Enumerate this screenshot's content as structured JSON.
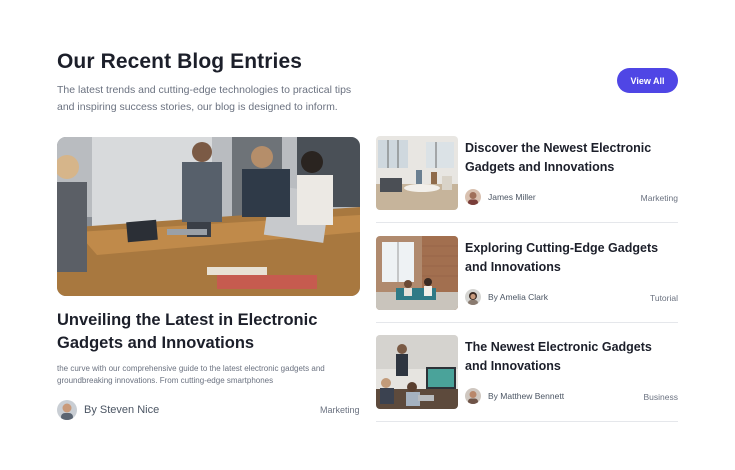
{
  "header": {
    "title": "Our Recent Blog Entries",
    "subtitle": "The latest trends and cutting-edge technologies to practical tips and inspiring success stories, our blog is designed to inform.",
    "view_all_label": "View All",
    "accent_color": "#4f46e5"
  },
  "featured": {
    "image_icon": "meeting-photo",
    "title": "Unveiling the Latest in Electronic Gadgets and Innovations",
    "excerpt": "the curve with our comprehensive guide to the latest electronic gadgets and groundbreaking innovations. From cutting-edge smartphones",
    "author": "By Steven Nice",
    "category": "Marketing"
  },
  "posts": [
    {
      "title": "Discover the Newest Electronic Gadgets and Innovations",
      "author": "James Miller",
      "category": "Marketing"
    },
    {
      "title": "Exploring Cutting-Edge Gadgets and Innovations",
      "author": "By Amelia Clark",
      "category": "Tutorial"
    },
    {
      "title": "The Newest Electronic Gadgets and Innovations",
      "author": "By Matthew Bennett",
      "category": "Business"
    }
  ]
}
